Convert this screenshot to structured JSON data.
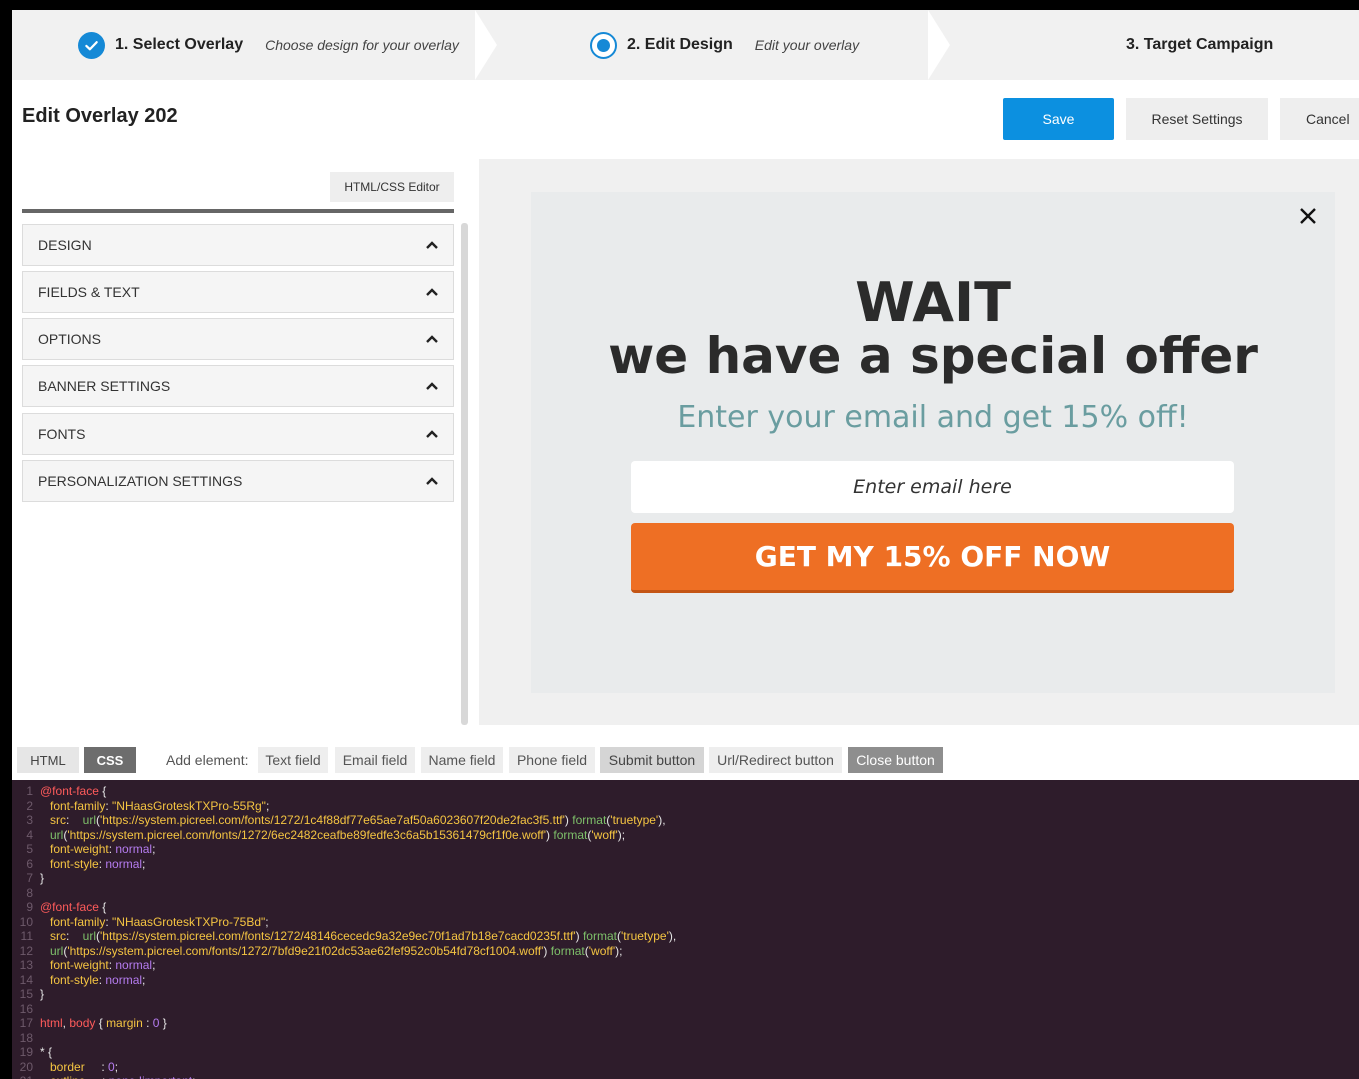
{
  "stepper": {
    "step1": {
      "title": "1. Select Overlay",
      "subtitle": "Choose design for your overlay"
    },
    "step2": {
      "title": "2. Edit Design",
      "subtitle": "Edit your overlay"
    },
    "step3": {
      "title": "3. Target Campaign"
    }
  },
  "header": {
    "title": "Edit Overlay 202",
    "save_label": "Save",
    "reset_label": "Reset Settings",
    "cancel_label": "Cancel"
  },
  "panel": {
    "editor_button": "HTML/CSS Editor",
    "sections": [
      "DESIGN",
      "FIELDS & TEXT",
      "OPTIONS",
      "BANNER SETTINGS",
      "FONTS",
      "PERSONALIZATION SETTINGS"
    ]
  },
  "preview": {
    "headline": "WAIT",
    "subheadline": "we have a special offer",
    "tagline": "Enter your email and get 15% off!",
    "email_placeholder": "Enter email here",
    "cta_label": "GET MY 15% OFF NOW"
  },
  "code_toolbar": {
    "tab_html": "HTML",
    "tab_css": "CSS",
    "add_element_label": "Add element:",
    "chips": [
      "Text field",
      "Email field",
      "Name field",
      "Phone field",
      "Submit button",
      "Url/Redirect button",
      "Close button"
    ]
  },
  "code": {
    "font1_family": "\"NHaasGroteskTXPro-55Rg\"",
    "font1_url1": "'https://system.picreel.com/fonts/1272/1c4f88df77e65ae7af50a6023607f20de2fac3f5.ttf'",
    "font1_url2": "'https://system.picreel.com/fonts/1272/6ec2482ceafbe89fedfe3c6a5b15361479cf1f0e.woff'",
    "font2_family": "\"NHaasGroteskTXPro-75Bd\"",
    "font2_url1": "'https://system.picreel.com/fonts/1272/48146cecedc9a32e9ec70f1ad7b18e7cacd0235f.ttf'",
    "font2_url2": "'https://system.picreel.com/fonts/1272/7bfd9e21f02dc53ae62fef952c0b54fd78cf1004.woff'"
  },
  "colors": {
    "primary": "#0c90e0",
    "cta": "#ee6f24",
    "tagline": "#6a9da0",
    "code_bg": "#2e1c2b"
  }
}
